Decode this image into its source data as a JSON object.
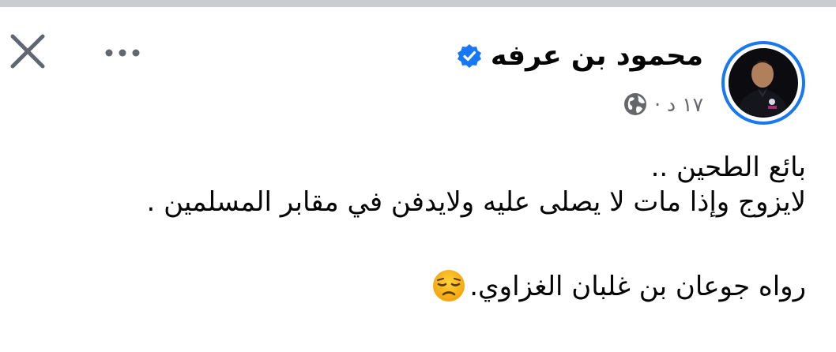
{
  "post": {
    "author": {
      "name": "محمود بن عرفه",
      "verified": true
    },
    "meta": {
      "time": "١٧ د",
      "separator": "·",
      "audience_icon": "globe-icon"
    },
    "lines": [
      "بائع الطحين ..",
      "لايزوج وإذا مات لا يصلى عليه ولايدفن في مقابر المسلمين .",
      "رواه جوعان بن غلبان الغزاوي."
    ],
    "emoji": "disappointed-face"
  },
  "controls": {
    "close_icon": "close-icon",
    "more_icon": "more-options-icon"
  },
  "colors": {
    "accent": "#1877f2",
    "secondary_text": "#65676b",
    "top_strip": "#c9ccd1"
  }
}
